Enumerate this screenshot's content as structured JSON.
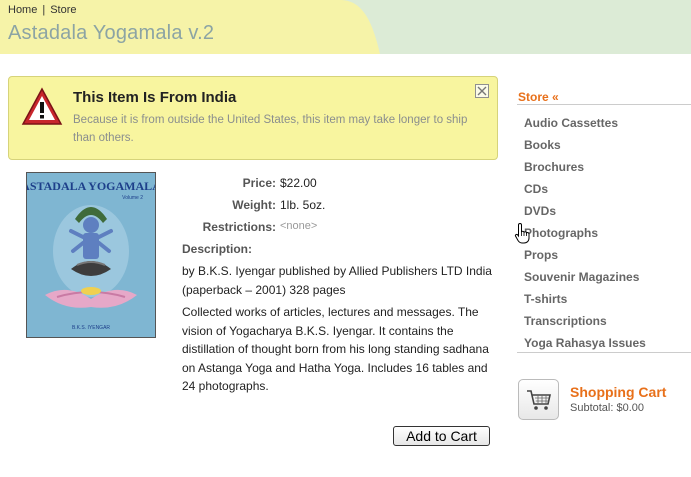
{
  "breadcrumb": {
    "home": "Home",
    "separator": "|",
    "store": "Store"
  },
  "site_title": "Astadala Yogamala v.2",
  "alert": {
    "icon": "warning-triangle-icon",
    "title": "This Item Is From India",
    "text": "Because it is from outside the United States, this item may take longer to ship than others.",
    "close_icon": "close-icon"
  },
  "product": {
    "cover_title": "ASTADALA YOGAMALA",
    "cover_volume": "Volume 2",
    "cover_author": "B.K.S. IYENGAR",
    "price_label": "Price:",
    "price": "$22.00",
    "weight_label": "Weight:",
    "weight": "1lb. 5oz.",
    "restrictions_label": "Restrictions:",
    "restrictions": "<none>",
    "description_label": "Description:",
    "description_1": "by B.K.S. Iyengar published by Allied Publishers LTD India (paperback – 2001) 328 pages",
    "description_2": "Collected works of articles, lectures and messages. The vision of Yogacharya B.K.S. Iyengar. It contains the distillation of thought born from his long standing sadhana on Astanga Yoga and Hatha Yoga. Includes 16 tables and 24 photographs.",
    "add_to_cart": "Add to Cart"
  },
  "sidebar": {
    "heading": "Store «",
    "items": [
      "Audio Cassettes",
      "Books",
      "Brochures",
      "CDs",
      "DVDs",
      "Photographs",
      "Props",
      "Souvenir Magazines",
      "T-shirts",
      "Transcriptions",
      "Yoga Rahasya Issues"
    ]
  },
  "cart": {
    "icon": "shopping-cart-icon",
    "title": "Shopping Cart",
    "subtotal": "Subtotal: $0.00"
  },
  "colors": {
    "accent": "#e8701a",
    "alert_bg": "#f8f59f",
    "header_green": "#dcebd6",
    "header_yellow": "#f6f3a8",
    "title_color": "#8ca4a4"
  }
}
